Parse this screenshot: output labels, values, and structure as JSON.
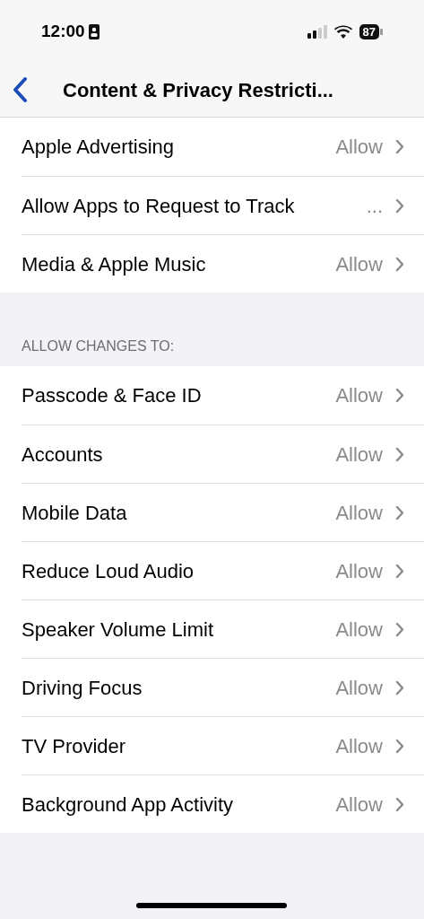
{
  "status_bar": {
    "time": "12:00",
    "battery": "87"
  },
  "nav": {
    "title": "Content & Privacy Restricti..."
  },
  "groups": [
    {
      "rows": [
        {
          "label": "Apple Advertising",
          "value": "Allow"
        },
        {
          "label": "Allow Apps to Request to Track",
          "value": "..."
        },
        {
          "label": "Media & Apple Music",
          "value": "Allow"
        }
      ]
    },
    {
      "header": "ALLOW CHANGES TO:",
      "rows": [
        {
          "label": "Passcode & Face ID",
          "value": "Allow"
        },
        {
          "label": "Accounts",
          "value": "Allow"
        },
        {
          "label": "Mobile Data",
          "value": "Allow"
        },
        {
          "label": "Reduce Loud Audio",
          "value": "Allow"
        },
        {
          "label": "Speaker Volume Limit",
          "value": "Allow"
        },
        {
          "label": "Driving Focus",
          "value": "Allow"
        },
        {
          "label": "TV Provider",
          "value": "Allow"
        },
        {
          "label": "Background App Activity",
          "value": "Allow"
        }
      ]
    }
  ]
}
